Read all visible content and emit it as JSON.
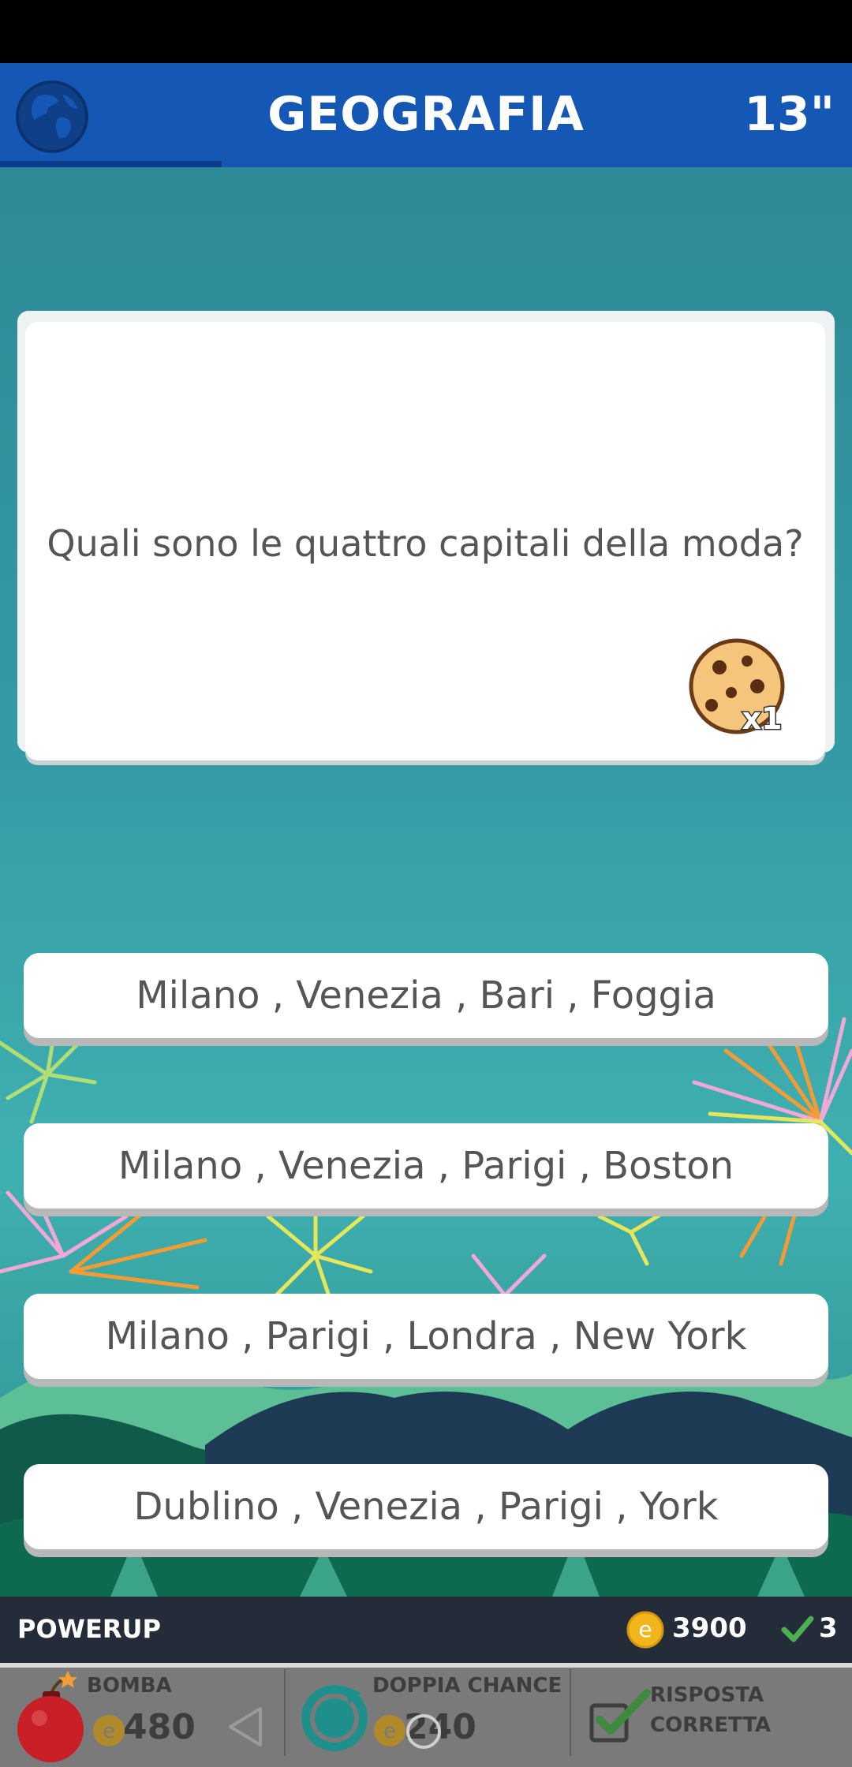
{
  "header": {
    "category": "GEOGRAFIA",
    "timer": "13\"",
    "progress_fraction": 0.26
  },
  "question": {
    "text": "Quali sono le quattro capitali della moda?",
    "cookie_multiplier": "x1"
  },
  "answers": [
    "Milano , Venezia , Bari , Foggia",
    "Milano , Venezia , Parigi , Boston",
    "Milano , Parigi , Londra , New York",
    "Dublino , Venezia , Parigi , York"
  ],
  "powerup_bar": {
    "label": "POWERUP",
    "coins": "3900",
    "correct_count": "3"
  },
  "powerups": {
    "bomb": {
      "name": "BOMBA",
      "price": "480"
    },
    "double": {
      "name": "DOPPIA CHANCE",
      "price": "240"
    },
    "correct": {
      "name_line1": "RISPOSTA",
      "name_line2": "CORRETTA"
    }
  },
  "colors": {
    "header": "#1557b5",
    "coin": "#f2b51c",
    "check": "#4caf50",
    "bomb": "#c81f26",
    "double": "#1f8f8c"
  }
}
